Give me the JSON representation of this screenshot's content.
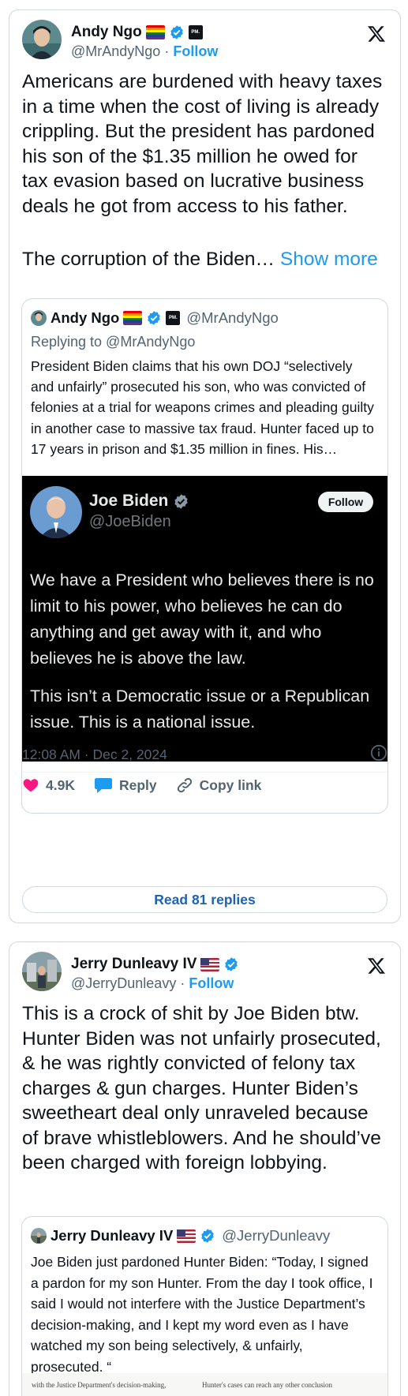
{
  "tweet1": {
    "author": {
      "name": "Andy Ngo",
      "handle": "@MrAndyNgo",
      "follow_label": "Follow",
      "separator": "·",
      "affiliate_text": "PM."
    },
    "body": "Americans are burdened with heavy taxes in a time when the cost of living is already crippling. But the president has pardoned his son of the $1.35 million he owed for tax evasion based on lucrative business deals he got from access to his father.",
    "body2": "The corruption of the Biden… ",
    "show_more": "Show more",
    "quote": {
      "author_name": "Andy Ngo",
      "author_handle": "@MrAndyNgo",
      "replying_to": "Replying to @MrAndyNgo",
      "text": "President Biden claims that his own DOJ “selectively and unfairly” prosecuted his son, who was convicted of felonies at a trial for weapons crimes and pleading guilty in another case to massive tax fraud. Hunter faced up to 17 years in prison and $1.35 million in fines. His…",
      "media": {
        "name": "Joe Biden",
        "handle": "@JoeBiden",
        "follow_label": "Follow",
        "text1": "We have a President who believes there is no limit to his power, who believes he can do anything and get away with it, and who believes he is above the law.",
        "text2": "This isn’t a Democratic issue or a Republican issue. This is a national issue."
      }
    },
    "timestamp": "12:08 AM · Dec 2, 2024",
    "likes": "4.9K",
    "reply_label": "Reply",
    "copy_label": "Copy link",
    "read_replies": "Read 81 replies",
    "colors": {
      "accent": "#1d9bf0",
      "like": "#f91880"
    }
  },
  "tweet2": {
    "author": {
      "name": "Jerry Dunleavy IV",
      "handle": "@JerryDunleavy",
      "follow_label": "Follow",
      "separator": "·"
    },
    "body": "This is a crock of shit by Joe Biden btw. Hunter Biden was not unfairly prosecuted, & he was rightly convicted of felony tax charges & gun charges. Hunter Biden’s sweetheart deal only unraveled because of brave whistleblowers. And he should’ve been charged with foreign lobbying.",
    "quote": {
      "author_name": "Jerry Dunleavy IV",
      "author_handle": "@JerryDunleavy",
      "text": "Joe Biden just pardoned Hunter Biden: “Today, I signed a pardon for my son Hunter. From the day I took office, I said I would not interfere with the Justice Department’s decision-making, and I kept my word even as I have watched my son being selectively, & unfairly, prosecuted. “",
      "doc_left": "with the Justice Department's decision-making,",
      "doc_right": "Hunter's cases can reach any other conclusion"
    }
  },
  "icons": [
    "x-logo-icon",
    "verified-badge-icon",
    "heart-icon",
    "reply-bubble-icon",
    "link-icon",
    "info-icon"
  ]
}
